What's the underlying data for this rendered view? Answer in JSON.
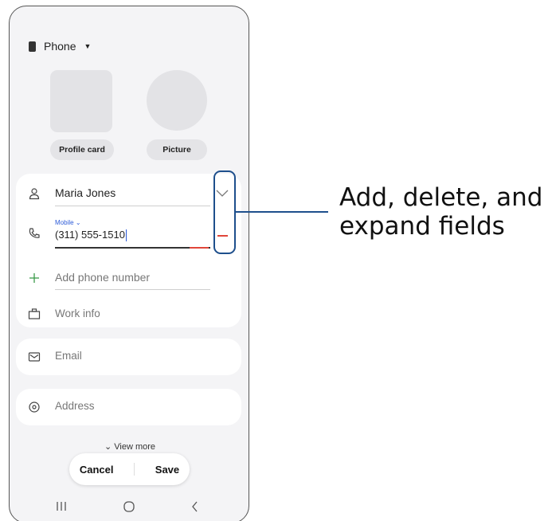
{
  "storage": {
    "label": "Phone"
  },
  "profile": {
    "card_label": "Profile card",
    "picture_label": "Picture"
  },
  "fields": {
    "name_value": "Maria Jones",
    "phone_type": "Mobile",
    "phone_value": "(311) 555-1510",
    "add_phone_placeholder": "Add phone number",
    "work_info_label": "Work info",
    "email_placeholder": "Email",
    "address_placeholder": "Address"
  },
  "view_more_label": "View more",
  "actions": {
    "cancel_label": "Cancel",
    "save_label": "Save"
  },
  "callout": {
    "line1": "Add, delete, and",
    "line2": "expand fields"
  },
  "colors": {
    "callout": "#1e4f8c",
    "delete_red": "#e0463a",
    "add_green": "#3b9b4a",
    "accent_blue": "#2d5bd8"
  },
  "icons": [
    "phone-device-icon",
    "caret-down-icon",
    "person-icon",
    "chevron-down-icon",
    "call-icon",
    "minus-icon",
    "plus-icon",
    "briefcase-icon",
    "mail-icon",
    "location-pin-icon",
    "recents-icon",
    "home-icon",
    "back-icon"
  ]
}
